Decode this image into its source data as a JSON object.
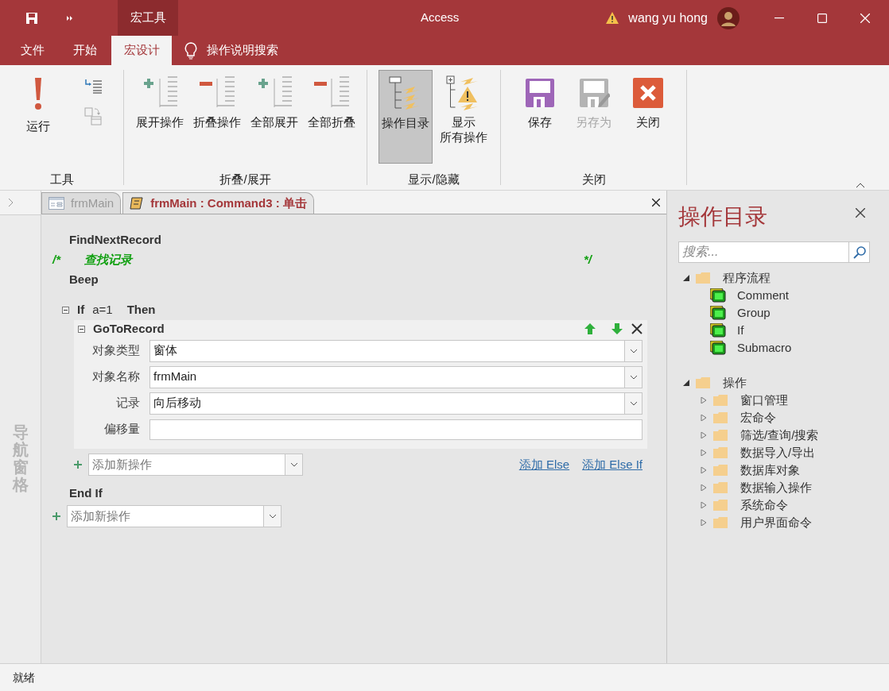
{
  "title_bar": {
    "contextual_tab": "宏工具",
    "app_title": "Access",
    "user": "wang yu hong"
  },
  "ribbon_tabs": [
    {
      "label": "文件",
      "selected": false
    },
    {
      "label": "开始",
      "selected": false
    },
    {
      "label": "宏设计",
      "selected": true
    }
  ],
  "tell_me": "操作说明搜索",
  "ribbon_groups": [
    {
      "label": "工具",
      "buttons": [
        {
          "kind": "run",
          "label": "运行",
          "selected": false,
          "disabled": false
        },
        {
          "kind": "step",
          "selected": false,
          "disabled": false
        },
        {
          "kind": "convert",
          "selected": false,
          "disabled": true
        }
      ]
    },
    {
      "label": "折叠/展开",
      "buttons": [
        {
          "kind": "expand",
          "label": "展开操作",
          "selected": false,
          "disabled": false
        },
        {
          "kind": "collapse",
          "label": "折叠操作",
          "selected": false,
          "disabled": false
        },
        {
          "kind": "expand",
          "label": "全部展开",
          "selected": false,
          "disabled": false
        },
        {
          "kind": "collapse",
          "label": "全部折叠",
          "selected": false,
          "disabled": false
        }
      ]
    },
    {
      "label": "显示/隐藏",
      "buttons": [
        {
          "kind": "catalog",
          "label": "操作目录",
          "selected": true,
          "disabled": false
        },
        {
          "kind": "show_all",
          "label_lines": [
            "显示",
            "所有操作"
          ],
          "selected": false,
          "disabled": false
        }
      ]
    },
    {
      "label": "关闭",
      "buttons": [
        {
          "kind": "save",
          "label": "保存",
          "selected": false,
          "disabled": false
        },
        {
          "kind": "save_as",
          "label": "另存为",
          "selected": false,
          "disabled": true
        },
        {
          "kind": "close",
          "label": "关闭",
          "selected": false,
          "disabled": false
        }
      ]
    }
  ],
  "nav_pane": "导航窗格",
  "document_tabs": [
    {
      "label": "frmMain",
      "kind": "form",
      "selected": false
    },
    {
      "label": "frmMain : Command3 : 单击",
      "kind": "macro",
      "selected": true
    }
  ],
  "macro": {
    "lines": [
      {
        "kind": "action",
        "text": "FindNextRecord"
      },
      {
        "kind": "comment",
        "open": "/*",
        "text": "查找记录",
        "close": "*/"
      },
      {
        "kind": "action",
        "text": "Beep"
      }
    ],
    "if_block": {
      "keyword": "If",
      "condition": "a=1",
      "then": "Then",
      "expanded": true,
      "action": {
        "name": "GoToRecord",
        "expanded": true,
        "args": [
          {
            "label": "对象类型",
            "value": "窗体",
            "kind": "dropdown"
          },
          {
            "label": "对象名称",
            "value": "frmMain",
            "kind": "dropdown"
          },
          {
            "label": "记录",
            "value": "向后移动",
            "kind": "dropdown"
          },
          {
            "label": "偏移量",
            "kind": "text"
          }
        ]
      },
      "add_placeholder": "添加新操作",
      "links": [
        "添加 Else",
        "添加 Else If"
      ],
      "end": "End If"
    },
    "add_placeholder": "添加新操作"
  },
  "catalog": {
    "title": "操作目录",
    "search_placeholder": "搜索...",
    "tree": [
      {
        "label": "程序流程",
        "expanded": true,
        "children": [
          {
            "label": "Comment"
          },
          {
            "label": "Group"
          },
          {
            "label": "If"
          },
          {
            "label": "Submacro"
          }
        ]
      },
      {
        "label": "操作",
        "expanded": true,
        "children": [
          {
            "label": "窗口管理",
            "expanded": false
          },
          {
            "label": "宏命令",
            "expanded": false
          },
          {
            "label": "筛选/查询/搜索",
            "expanded": false
          },
          {
            "label": "数据导入/导出",
            "expanded": false
          },
          {
            "label": "数据库对象",
            "expanded": false
          },
          {
            "label": "数据输入操作",
            "expanded": false
          },
          {
            "label": "系统命令",
            "expanded": false
          },
          {
            "label": "用户界面命令",
            "expanded": false
          }
        ]
      }
    ]
  },
  "status_bar": "就绪"
}
